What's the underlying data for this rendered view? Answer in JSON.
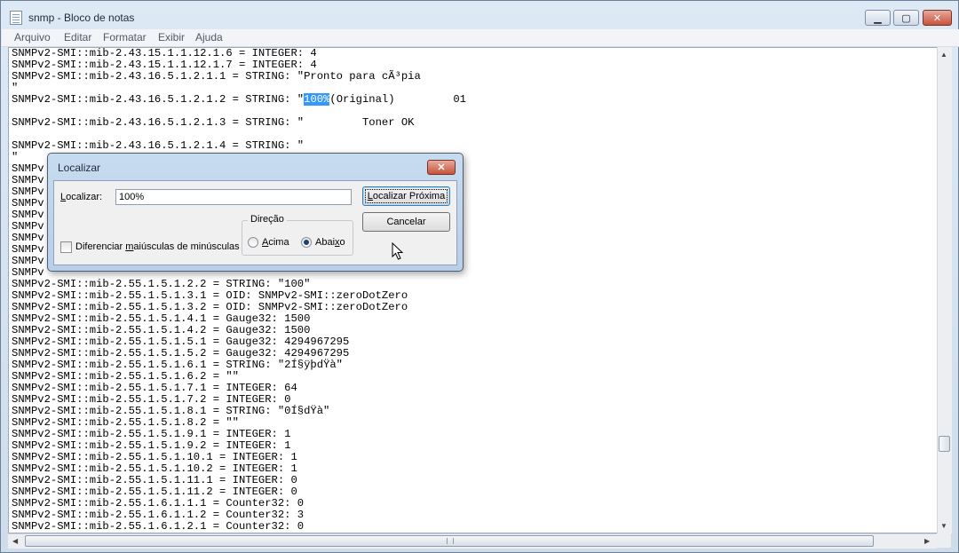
{
  "window": {
    "title": "snmp - Bloco de notas"
  },
  "caption": {
    "minimize": "▁",
    "maximize": "▢",
    "close": "✕"
  },
  "menu": [
    "Arquivo",
    "Editar",
    "Formatar",
    "Exibir",
    "Ajuda"
  ],
  "editor": {
    "lines_before": [
      "SNMPv2-SMI::mib-2.43.15.1.1.12.1.6 = INTEGER: 4",
      "SNMPv2-SMI::mib-2.43.15.1.1.12.1.7 = INTEGER: 4",
      "SNMPv2-SMI::mib-2.43.16.5.1.2.1.1 = STRING: \"Pronto para cÃ³pia",
      "\"",
      "SNMPv2-SMI::mib-2.43.16.5.1.2.1.2 = STRING: \""
    ],
    "highlight": "100%",
    "highlight_after": "(Original)         01",
    "lines_after": [
      "",
      "SNMPv2-SMI::mib-2.43.16.5.1.2.1.3 = STRING: \"         Toner OK",
      "",
      "SNMPv2-SMI::mib-2.43.16.5.1.2.1.4 = STRING: \"",
      "\"",
      "SNMPv",
      "SNMPv",
      "SNMPv",
      "SNMPv",
      "SNMPv",
      "SNMPv",
      "SNMPv",
      "SNMPv",
      "SNMPv",
      "SNMPv",
      "SNMPv2-SMI::mib-2.55.1.5.1.2.2 = STRING: \"100\"",
      "SNMPv2-SMI::mib-2.55.1.5.1.3.1 = OID: SNMPv2-SMI::zeroDotZero",
      "SNMPv2-SMI::mib-2.55.1.5.1.3.2 = OID: SNMPv2-SMI::zeroDotZero",
      "SNMPv2-SMI::mib-2.55.1.5.1.4.1 = Gauge32: 1500",
      "SNMPv2-SMI::mib-2.55.1.5.1.4.2 = Gauge32: 1500",
      "SNMPv2-SMI::mib-2.55.1.5.1.5.1 = Gauge32: 4294967295",
      "SNMPv2-SMI::mib-2.55.1.5.1.5.2 = Gauge32: 4294967295",
      "SNMPv2-SMI::mib-2.55.1.5.1.6.1 = STRING: \"2Í§ÿþdŸà\"",
      "SNMPv2-SMI::mib-2.55.1.5.1.6.2 = \"\"",
      "SNMPv2-SMI::mib-2.55.1.5.1.7.1 = INTEGER: 64",
      "SNMPv2-SMI::mib-2.55.1.5.1.7.2 = INTEGER: 0",
      "SNMPv2-SMI::mib-2.55.1.5.1.8.1 = STRING: \"0Í§dŸà\"",
      "SNMPv2-SMI::mib-2.55.1.5.1.8.2 = \"\"",
      "SNMPv2-SMI::mib-2.55.1.5.1.9.1 = INTEGER: 1",
      "SNMPv2-SMI::mib-2.55.1.5.1.9.2 = INTEGER: 1",
      "SNMPv2-SMI::mib-2.55.1.5.1.10.1 = INTEGER: 1",
      "SNMPv2-SMI::mib-2.55.1.5.1.10.2 = INTEGER: 1",
      "SNMPv2-SMI::mib-2.55.1.5.1.11.1 = INTEGER: 0",
      "SNMPv2-SMI::mib-2.55.1.5.1.11.2 = INTEGER: 0",
      "SNMPv2-SMI::mib-2.55.1.6.1.1.1 = Counter32: 0",
      "SNMPv2-SMI::mib-2.55.1.6.1.1.2 = Counter32: 3",
      "SNMPv2-SMI::mib-2.55.1.6.1.2.1 = Counter32: 0"
    ]
  },
  "find_dialog": {
    "title": "Localizar",
    "close": "✕",
    "find_label_pre": "",
    "find_label_u": "L",
    "find_label_post": "ocalizar:",
    "find_value": "100%",
    "find_next_pre": "",
    "find_next_u": "L",
    "find_next_post": "ocalizar Próxima",
    "cancel": "Cancelar",
    "direction_label": "Direção",
    "up_pre": "",
    "up_u": "A",
    "up_post": "cima",
    "down_pre": "Abai",
    "down_u": "x",
    "down_post": "o",
    "match_case_pre": "Diferenciar ",
    "match_case_u": "m",
    "match_case_post": "aiúsculas de minúsculas"
  },
  "colors": {
    "selection": "#3399ff",
    "close_button": "#c6533c"
  }
}
